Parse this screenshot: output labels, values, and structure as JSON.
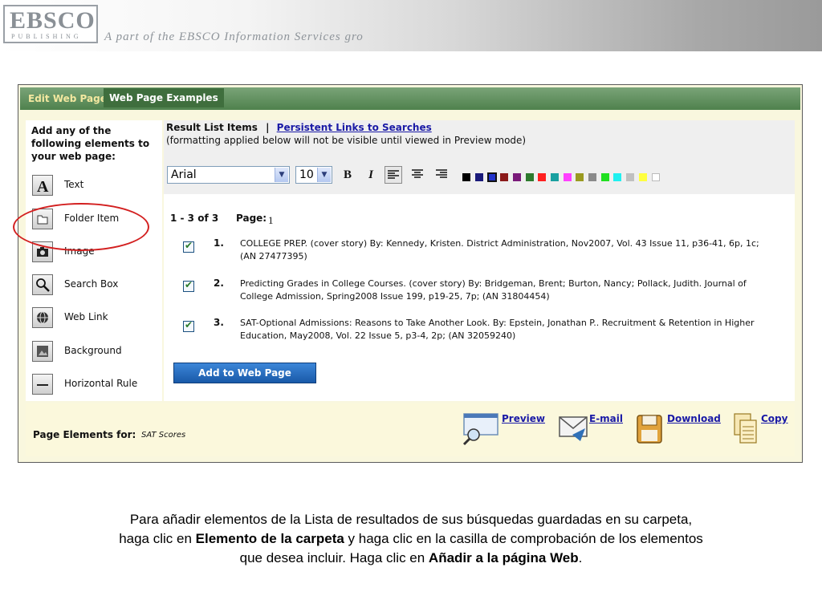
{
  "banner": {
    "logo_main": "EBSCO",
    "logo_sub": "PUBLISHING",
    "tagline": "A part of the EBSCO Information Services gro"
  },
  "toolbar": {
    "edit_web_page": "Edit Web Page",
    "web_page_examples": "Web Page Examples"
  },
  "left_panel": {
    "title": "Add any of the following elements to your web page:",
    "items": [
      {
        "label": "Text",
        "icon": "text-A-icon"
      },
      {
        "label": "Folder Item",
        "icon": "folder-icon"
      },
      {
        "label": "Image",
        "icon": "camera-icon"
      },
      {
        "label": "Search Box",
        "icon": "magnifier-icon"
      },
      {
        "label": "Web Link",
        "icon": "globe-link-icon"
      },
      {
        "label": "Background",
        "icon": "background-icon"
      },
      {
        "label": "Horizontal Rule",
        "icon": "horizontal-rule-icon"
      }
    ]
  },
  "result_list": {
    "title": "Result List Items",
    "separator": "|",
    "persistent_link": "Persistent Links to Searches",
    "note": "(formatting applied below will not be visible until viewed in Preview mode)",
    "font_select": "Arial",
    "size_select": "10",
    "bold": "B",
    "italic": "I",
    "colors": [
      "#000000",
      "#1a1a7a",
      "#2233cc",
      "#8b1a1a",
      "#7a1a7a",
      "#2d7a2d",
      "#ff2020",
      "#19a0a0",
      "#ff40ff",
      "#9a9a20",
      "#8a8a8a",
      "#20e020",
      "#20f0f0",
      "#c0c0c0",
      "#ffff40",
      "#ffffff"
    ],
    "count": "1 - 3 of 3",
    "page_label": "Page:",
    "page_num": "1",
    "items": [
      {
        "num": "1.",
        "text": "COLLEGE PREP. (cover story) By: Kennedy, Kristen. District Administration, Nov2007, Vol. 43 Issue 11, p36-41, 6p, 1c; (AN 27477395)"
      },
      {
        "num": "2.",
        "text": "Predicting Grades in College Courses. (cover story) By: Bridgeman, Brent; Burton, Nancy; Pollack, Judith. Journal of College Admission, Spring2008 Issue 199, p19-25, 7p; (AN 31804454)"
      },
      {
        "num": "3.",
        "text": "SAT-Optional Admissions: Reasons to Take Another Look. By: Epstein, Jonathan P.. Recruitment & Retention in Higher Education, May2008, Vol. 22 Issue 5, p3-4, 2p; (AN 32059240)"
      }
    ],
    "add_button": "Add to Web Page"
  },
  "page_elements": {
    "label": "Page Elements for:",
    "value": "SAT Scores",
    "tools": [
      {
        "label": "Preview",
        "icon": "preview-icon"
      },
      {
        "label": "E-mail",
        "icon": "email-icon"
      },
      {
        "label": "Download",
        "icon": "download-icon"
      },
      {
        "label": "Copy",
        "icon": "copy-icon"
      }
    ]
  },
  "caption": {
    "line1": "Para añadir elementos de la Lista de resultados de sus búsquedas guardadas en su carpeta,",
    "line2_pre": "haga clic en ",
    "line2_bold": "Elemento de la carpeta",
    "line2_post": " y haga clic en la casilla de comprobación de los elementos",
    "line3_pre": "que desea incluir. Haga clic en ",
    "line3_bold": "Añadir a la página Web",
    "line3_post": "."
  }
}
